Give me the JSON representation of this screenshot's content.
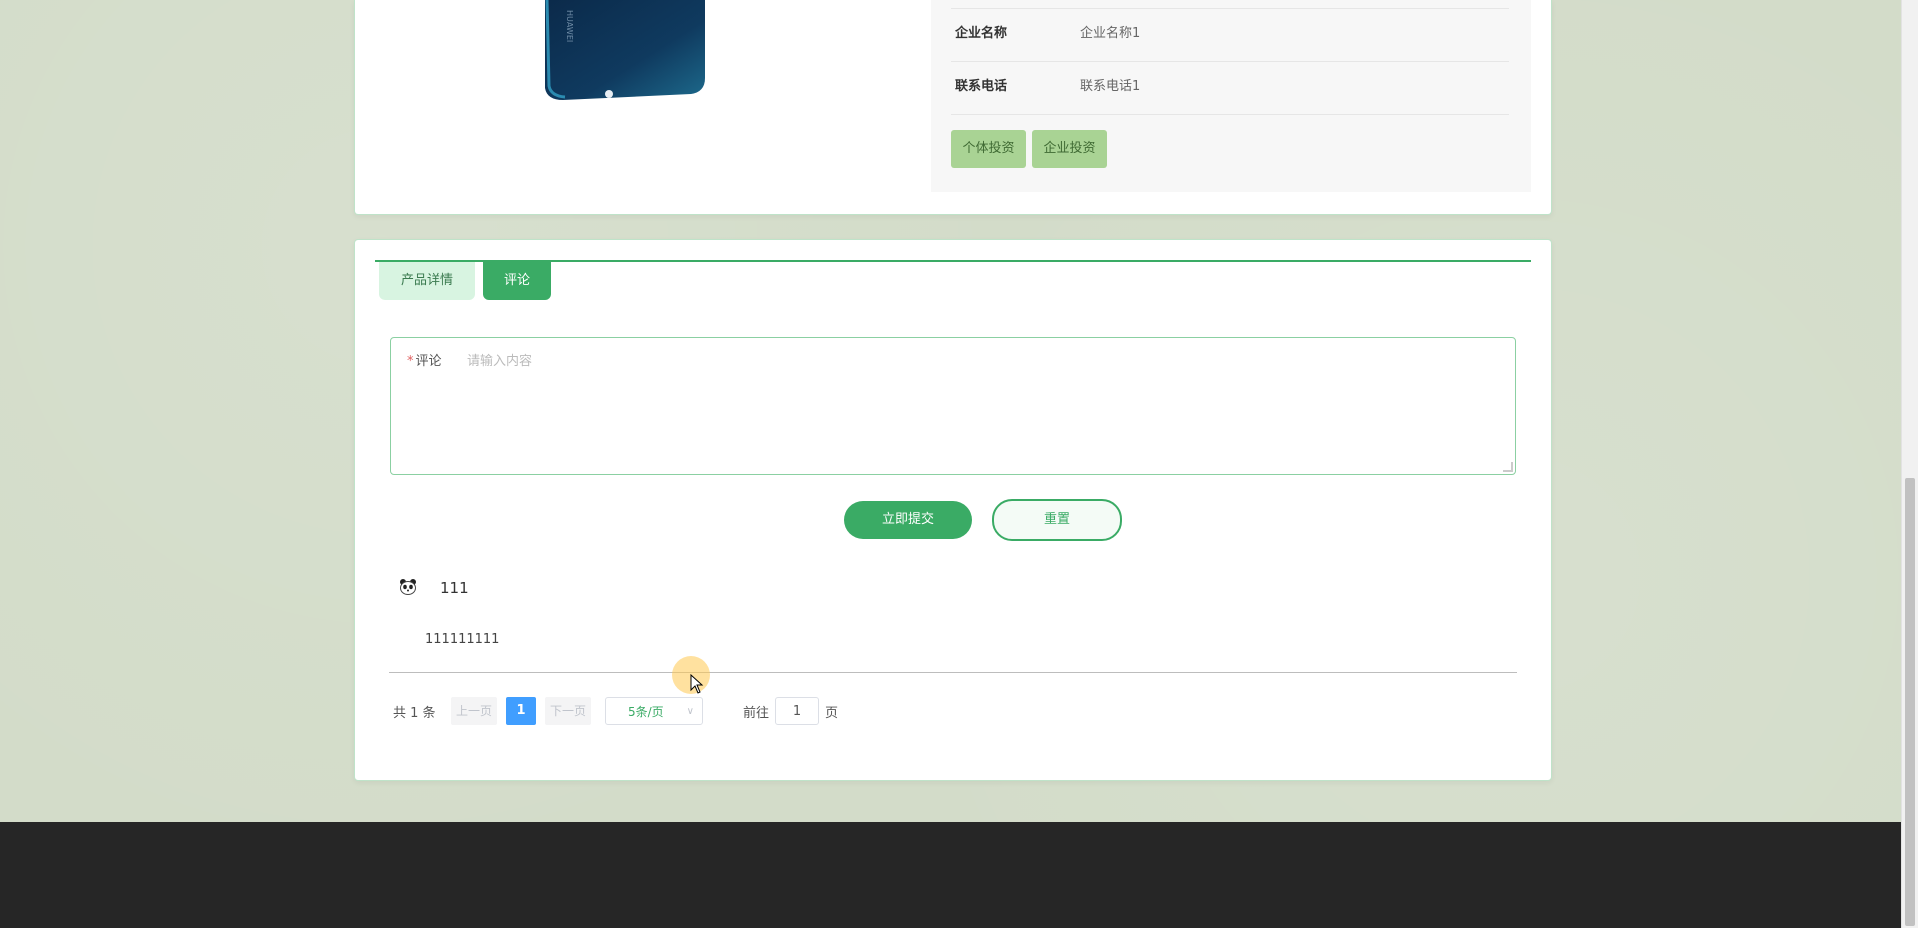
{
  "product_info": {
    "rows": [
      {
        "label": "企业名称",
        "value": "企业名称1"
      },
      {
        "label": "联系电话",
        "value": "联系电话1"
      }
    ],
    "buttons": {
      "individual": "个体投资",
      "enterprise": "企业投资"
    },
    "phone_brand_text": "HUAWEI"
  },
  "tabs": {
    "detail": "产品详情",
    "comment": "评论",
    "active": "comment"
  },
  "comment_form": {
    "required_mark": "*",
    "label": "评论",
    "placeholder": "请输入内容",
    "value": "",
    "submit_label": "立即提交",
    "reset_label": "重置"
  },
  "comments": [
    {
      "user": "111",
      "avatar_icon": "panda-icon",
      "content": "111111111"
    }
  ],
  "pagination": {
    "total_text": "共 1 条",
    "prev_label": "上一页",
    "current_page": "1",
    "next_label": "下一页",
    "page_size": "5条/页",
    "goto_label": "前往",
    "goto_value": "1",
    "goto_suffix": "页"
  },
  "colors": {
    "accent": "#3aab65",
    "page_bg": "#d3dcc9",
    "footer_bg": "#262626",
    "pager_active": "#409eff",
    "invest_button": "#a9d394"
  }
}
